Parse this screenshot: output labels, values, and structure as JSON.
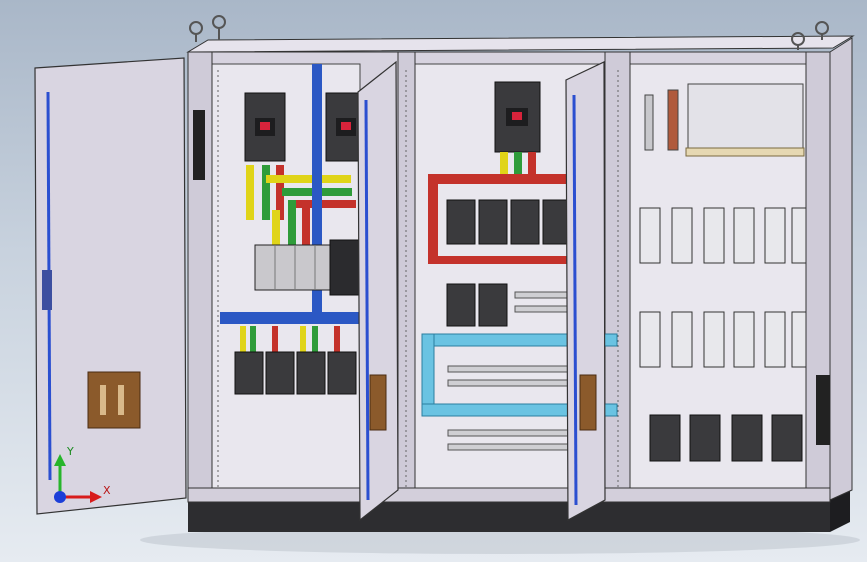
{
  "viewport": {
    "background_top": "#a9b7c8",
    "background_bottom": "#e6ebf1"
  },
  "model": {
    "cabinet_color": "#d7d3df",
    "door_color": "#d9d5e1",
    "plinth_color": "#2d2d30",
    "busbar_colors": {
      "yellow": "#e0d418",
      "green": "#2f9c3a",
      "red": "#c4322b",
      "blue": "#2b58c4",
      "cyan": "#62bfe0"
    }
  },
  "axis_triad": {
    "x_label": "X",
    "y_label": "Y",
    "x_color": "#d81c1c",
    "y_color": "#27b52b",
    "z_color": "#1c3fd8"
  }
}
